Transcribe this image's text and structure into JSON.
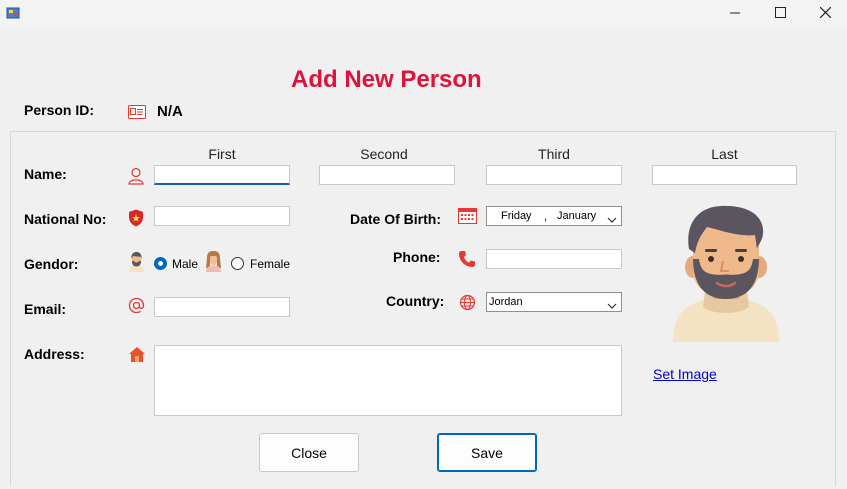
{
  "window": {
    "icons": {
      "app": "app-form-icon",
      "minimize": "minimize-icon",
      "maximize": "maximize-icon",
      "close": "close-icon"
    }
  },
  "form": {
    "title": "Add New Person",
    "person_id_label": "Person ID:",
    "person_id_value": "N/A",
    "name_label": "Name:",
    "columns": {
      "first": "First",
      "second": "Second",
      "third": "Third",
      "last": "Last"
    },
    "name_values": {
      "first": "",
      "second": "",
      "third": "",
      "last": ""
    },
    "national_no_label": "National No:",
    "national_no_value": "",
    "dob_label": "Date Of Birth:",
    "dob": {
      "day_name": "Friday",
      "separator": ",",
      "month": "January"
    },
    "gender_label": "Gendor:",
    "gender_options": {
      "male": "Male",
      "female": "Female"
    },
    "gender_selected": "Male",
    "phone_label": "Phone:",
    "phone_value": "",
    "email_label": "Email:",
    "email_value": "",
    "country_label": "Country:",
    "country_value": "Jordan",
    "address_label": "Address:",
    "address_value": "",
    "set_image_label": "Set Image",
    "close_label": "Close",
    "save_label": "Save"
  },
  "colors": {
    "title": "#dc143c",
    "accent": "#0067c0",
    "icon_red": "#e53935",
    "link": "#0000cc"
  }
}
